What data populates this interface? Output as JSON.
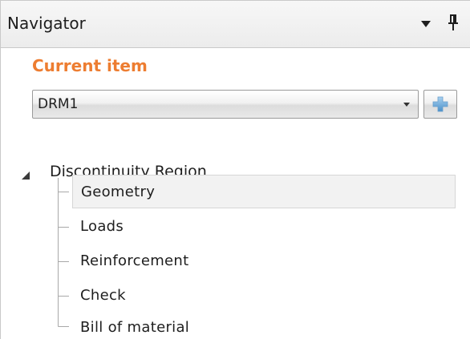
{
  "panel": {
    "title": "Navigator"
  },
  "current_item": {
    "label": "Current item",
    "value": "DRM1",
    "accent_color": "#ed7d31"
  },
  "tree": {
    "root": "Discontinuity Region",
    "items": [
      {
        "label": "Geometry",
        "selected": true
      },
      {
        "label": "Loads",
        "selected": false
      },
      {
        "label": "Reinforcement",
        "selected": false
      },
      {
        "label": "Check",
        "selected": false
      },
      {
        "label": "Bill of material",
        "selected": false
      }
    ]
  },
  "icons": {
    "title_dropdown": "chevron-down-icon",
    "pin": "pin-icon",
    "combo_dropdown": "chevron-down-icon",
    "add": "plus-icon",
    "tree_toggle": "expanded-triangle-icon"
  }
}
